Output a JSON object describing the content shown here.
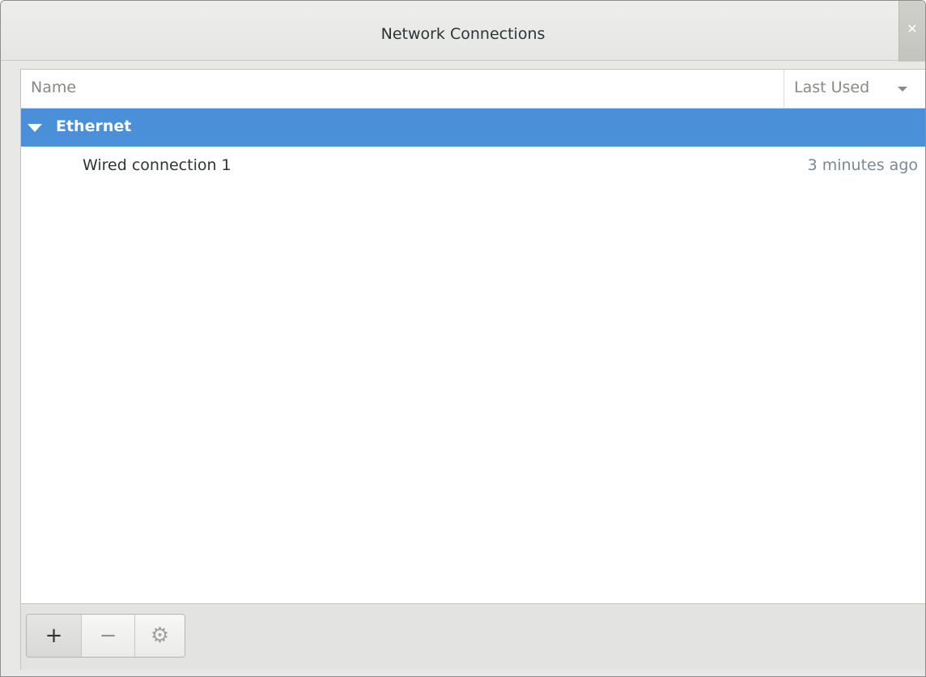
{
  "window": {
    "title": "Network Connections",
    "close_icon": "close-icon"
  },
  "columns": {
    "name": "Name",
    "last_used": "Last Used",
    "sort_icon": "chevron-down-icon"
  },
  "groups": [
    {
      "label": "Ethernet",
      "expanded": true,
      "selected": true,
      "connections": [
        {
          "name": "Wired connection 1",
          "last_used": "3 minutes ago"
        }
      ]
    }
  ],
  "toolbar": {
    "add_label": "+",
    "remove_label": "−",
    "settings_label": "⚙",
    "add_icon": "plus-icon",
    "remove_icon": "minus-icon",
    "settings_icon": "gear-icon"
  },
  "colors": {
    "selection": "#4a90d9",
    "secondary_text": "#7b8893"
  }
}
